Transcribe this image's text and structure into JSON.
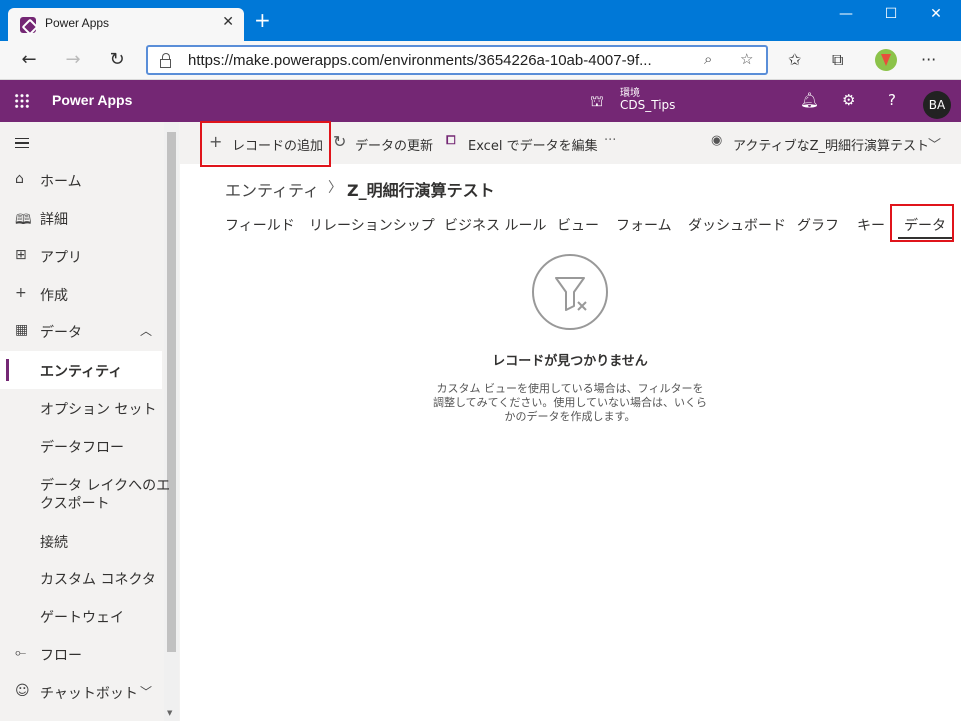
{
  "browser": {
    "tab_title": "Power Apps",
    "tab_close": "✕",
    "new_tab": "+",
    "url": "https://make.powerapps.com/environments/3654226a-10ab-4007-9f...",
    "window_controls": {
      "minimize": "—",
      "maximize": "☐",
      "close": "✕"
    }
  },
  "app": {
    "name": "Power Apps",
    "environment_label": "環境",
    "environment_name": "CDS_Tips",
    "avatar": "BA",
    "brand_color": "#742774"
  },
  "sidebar": {
    "items": [
      {
        "icon": "home-icon",
        "label": "ホーム"
      },
      {
        "icon": "book-icon",
        "label": "詳細"
      },
      {
        "icon": "apps-icon",
        "label": "アプリ"
      },
      {
        "icon": "plus-icon",
        "label": "作成"
      },
      {
        "icon": "table-icon",
        "label": "データ"
      }
    ],
    "data_children": [
      {
        "label": "エンティティ",
        "selected": true
      },
      {
        "label": "オプション セット"
      },
      {
        "label": "データフロー"
      },
      {
        "label": "データ レイクへのエ"
      },
      {
        "label": "クスポート"
      },
      {
        "label": "接続"
      },
      {
        "label": "カスタム コネクタ"
      },
      {
        "label": "ゲートウェイ"
      }
    ],
    "bottom_items": [
      {
        "icon": "flow-icon",
        "label": "フロー"
      },
      {
        "icon": "bot-icon",
        "label": "チャットボット"
      }
    ]
  },
  "commands": {
    "add_record": "レコードの追加",
    "refresh": "データの更新",
    "excel_prefix": "Excel",
    "excel_suffix": "でデータを編集",
    "more": "···",
    "view_selector": "アクティブなZ_明細行演算テスト"
  },
  "breadcrumb": {
    "parent": "エンティティ",
    "current": "Z_明細行演算テスト"
  },
  "entity_tabs": [
    {
      "label": "フィールド"
    },
    {
      "label": "リレーションシップ"
    },
    {
      "label": "ビジネス ルール"
    },
    {
      "label": "ビュー"
    },
    {
      "label": "フォーム"
    },
    {
      "label": "ダッシュボード"
    },
    {
      "label": "グラフ"
    },
    {
      "label": "キー"
    },
    {
      "label": "データ",
      "active": true
    }
  ],
  "empty_state": {
    "title": "レコードが見つかりません",
    "line1": "カスタム ビューを使用している場合は、フィルターを",
    "line2": "調整してみてください。使用していない場合は、いくら",
    "line3": "かのデータを作成します。"
  },
  "highlight_color": "#e0141b"
}
